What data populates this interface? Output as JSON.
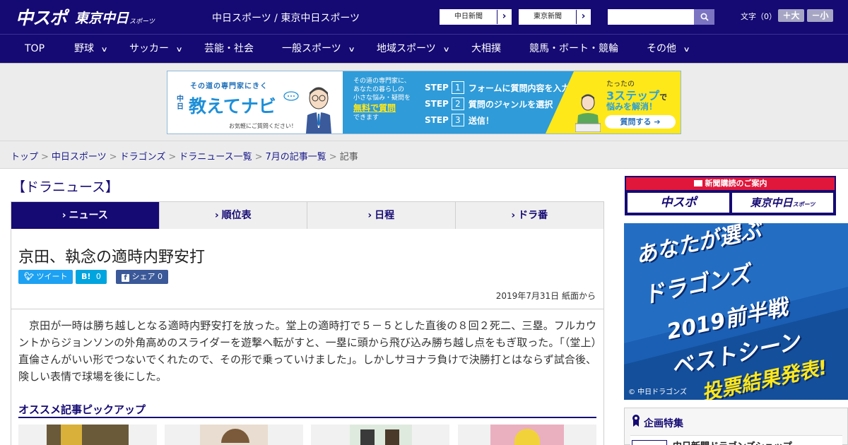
{
  "header": {
    "logo_main": "中スポ",
    "logo_tokyo": "東京中日",
    "logo_tokyo_sub": "スポーツ",
    "site_title": "中日スポーツ / 東京中日スポーツ",
    "links": [
      {
        "label": "中日新聞",
        "arrow": "›"
      },
      {
        "label": "東京新聞",
        "arrow": "›"
      }
    ],
    "search": {
      "placeholder": "",
      "value": ""
    },
    "font_size_label": "文字（0）",
    "font_larger": "＋大",
    "font_smaller": "－小"
  },
  "nav": {
    "items": [
      {
        "label": "TOP",
        "has_menu": false
      },
      {
        "label": "野球",
        "has_menu": true
      },
      {
        "label": "サッカー",
        "has_menu": true
      },
      {
        "label": "芸能・社会",
        "has_menu": false
      },
      {
        "label": "一般スポーツ",
        "has_menu": true
      },
      {
        "label": "地域スポーツ",
        "has_menu": true
      },
      {
        "label": "大相撲",
        "has_menu": false
      },
      {
        "label": "競馬・ボート・競輪",
        "has_menu": false
      },
      {
        "label": "その他",
        "has_menu": true
      }
    ]
  },
  "banner_ad": {
    "kicker": "その道の専門家にきく",
    "brand_prefix": "中日",
    "brand": "教えてナビ",
    "tagline": "お気軽にご質問ください！",
    "mid_text_1": "その道の専門家に、",
    "mid_text_2": "あなたの暮らしの",
    "mid_text_3": "小さな悩み・疑問を",
    "free_label": "無料で質問",
    "mid_text_4": "できます",
    "steps": [
      {
        "label": "STEP",
        "num": "1",
        "text": "フォームに質問内容を入力"
      },
      {
        "label": "STEP",
        "num": "2",
        "text": "質問のジャンルを選択"
      },
      {
        "label": "STEP",
        "num": "3",
        "text": "送信！"
      }
    ],
    "right_small": "たったの",
    "right_big": "3ステップ",
    "right_suffix": "で",
    "right_line2": "悩みを解消！",
    "cta": "質問する"
  },
  "breadcrumb": {
    "items": [
      "トップ",
      "中日スポーツ",
      "ドラゴンズ",
      "ドラニュース一覧",
      "7月の記事一覧"
    ],
    "current": "記事",
    "separator": ">"
  },
  "section_title": "【ドラニュース】",
  "tabs": [
    {
      "label": "ニュース",
      "caret": "›",
      "active": true
    },
    {
      "label": "順位表",
      "caret": "›",
      "active": false
    },
    {
      "label": "日程",
      "caret": "›",
      "active": false
    },
    {
      "label": "ドラ番",
      "caret": "›",
      "active": false
    }
  ],
  "article": {
    "headline": "京田、執念の適時内野安打",
    "share": {
      "tweet": "ツイート",
      "hatena_icon": "B!",
      "hatena_count": "0",
      "facebook_label": "シェア",
      "facebook_count": "0"
    },
    "date": "2019年7月31日 紙面から",
    "body": "京田が一時は勝ち越しとなる適時内野安打を放った。堂上の適時打で５－５とした直後の８回２死二、三塁。フルカウントからジョンソンの外角高めのスライダーを遊撃へ転がすと、一塁に頭から飛び込み勝ち越し点をもぎ取った。「（堂上）直倫さんがいい形でつないでくれたので、その形で乗っていけました」。しかしサヨナラ負けで決勝打とはならず試合後、険しい表情で球場を後にした。",
    "pickup_title": "オススメ記事ピックアップ"
  },
  "sidebar": {
    "subscribe_header": "新聞購読のご案内",
    "subscribe_logo_1": "中スポ",
    "subscribe_logo_2": "東京中日",
    "subscribe_logo_2_sub": "スポーツ",
    "vote_ad": {
      "line1": "あなたが選ぶ",
      "line2": "ドラゴンズ",
      "line3": "2019前半戦",
      "line4": "ベストシーン",
      "line5": "投票結果発表!",
      "copyright": "© 中日ドラゴンズ"
    },
    "feature_title": "企画特集",
    "feature_item": "中日新聞ドラゴンズショップ"
  },
  "colors": {
    "brand_navy": "#150a73",
    "accent_red": "#e0163b",
    "twitter": "#1da1f2",
    "hatena": "#00a4de",
    "facebook": "#3b5998"
  }
}
